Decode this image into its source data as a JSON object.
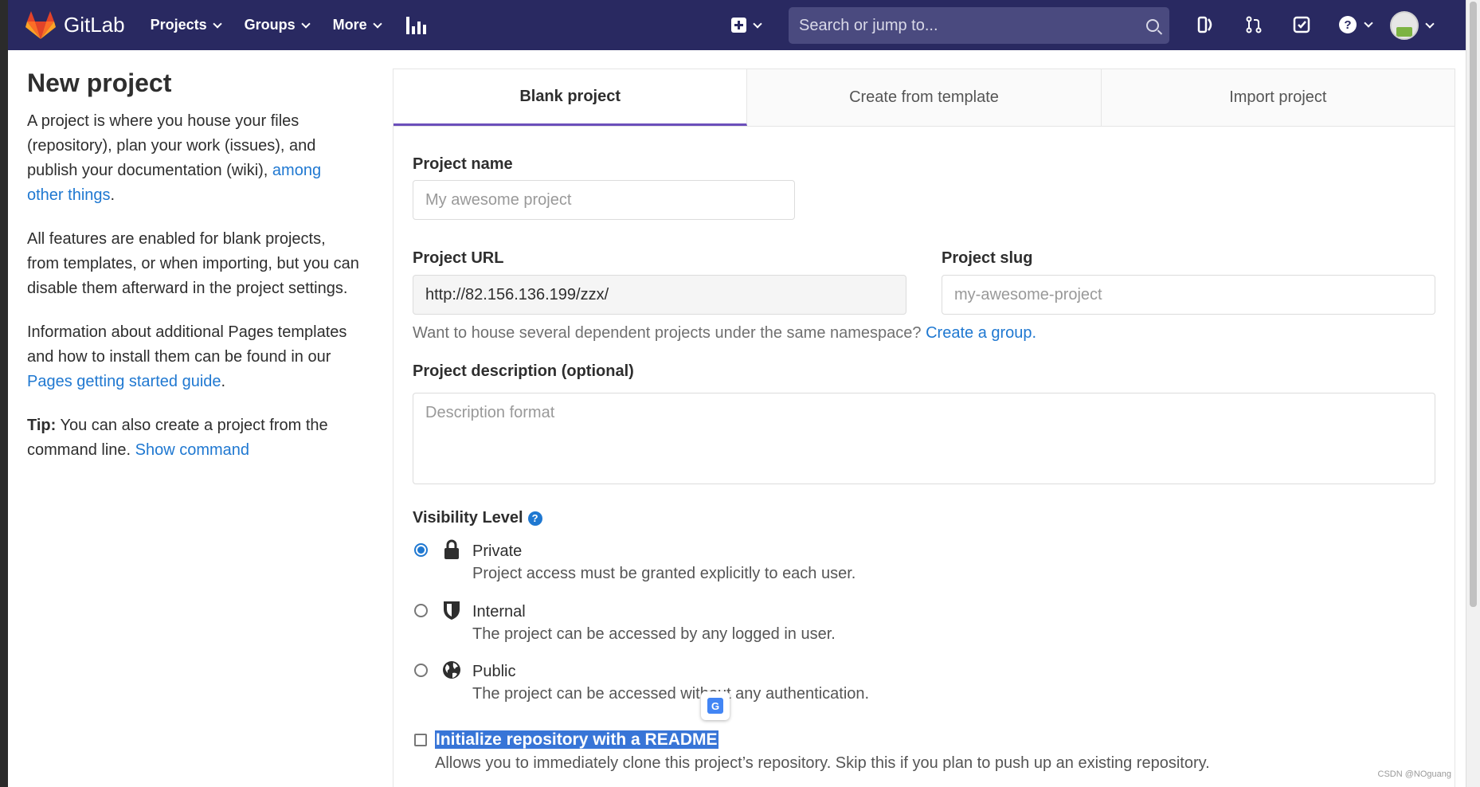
{
  "navbar": {
    "brand": "GitLab",
    "menu": [
      {
        "label": "Projects"
      },
      {
        "label": "Groups"
      },
      {
        "label": "More"
      }
    ],
    "search_placeholder": "Search or jump to..."
  },
  "sidebar": {
    "title": "New project",
    "para1_text": "A project is where you house your files (repository), plan your work (issues), and publish your documentation (wiki), ",
    "para1_link": "among other things",
    "para1_end": ".",
    "para2": "All features are enabled for blank projects, from templates, or when importing, but you can disable them afterward in the project settings.",
    "para3_text": "Information about additional Pages templates and how to install them can be found in our ",
    "para3_link": "Pages getting started guide",
    "para3_end": ".",
    "tip_label": "Tip:",
    "tip_text": " You can also create a project from the command line. ",
    "tip_link": "Show command"
  },
  "tabs": [
    {
      "label": "Blank project",
      "active": true
    },
    {
      "label": "Create from template",
      "active": false
    },
    {
      "label": "Import project",
      "active": false
    }
  ],
  "form": {
    "project_name_label": "Project name",
    "project_name_placeholder": "My awesome project",
    "project_url_label": "Project URL",
    "project_url_value": "http://82.156.136.199/zzx/",
    "project_slug_label": "Project slug",
    "project_slug_placeholder": "my-awesome-project",
    "namespace_help": "Want to house several dependent projects under the same namespace? ",
    "namespace_link": "Create a group.",
    "description_label": "Project description (optional)",
    "description_placeholder": "Description format",
    "visibility_label": "Visibility Level",
    "visibility_options": [
      {
        "name": "Private",
        "desc": "Project access must be granted explicitly to each user.",
        "checked": true,
        "icon": "lock-icon"
      },
      {
        "name": "Internal",
        "desc": "The project can be accessed by any logged in user.",
        "checked": false,
        "icon": "shield-icon"
      },
      {
        "name": "Public",
        "desc": "The project can be accessed without any authentication.",
        "checked": false,
        "icon": "globe-icon"
      }
    ],
    "readme_label": "Initialize repository with a README",
    "readme_desc": "Allows you to immediately clone this project’s repository. Skip this if you plan to push up an existing repository."
  },
  "watermark": "CSDN @NOguang",
  "colors": {
    "navbar": "#292961",
    "link": "#1f78d1",
    "active_tab_border": "#6b4fbb",
    "selection": "#3875d7"
  }
}
